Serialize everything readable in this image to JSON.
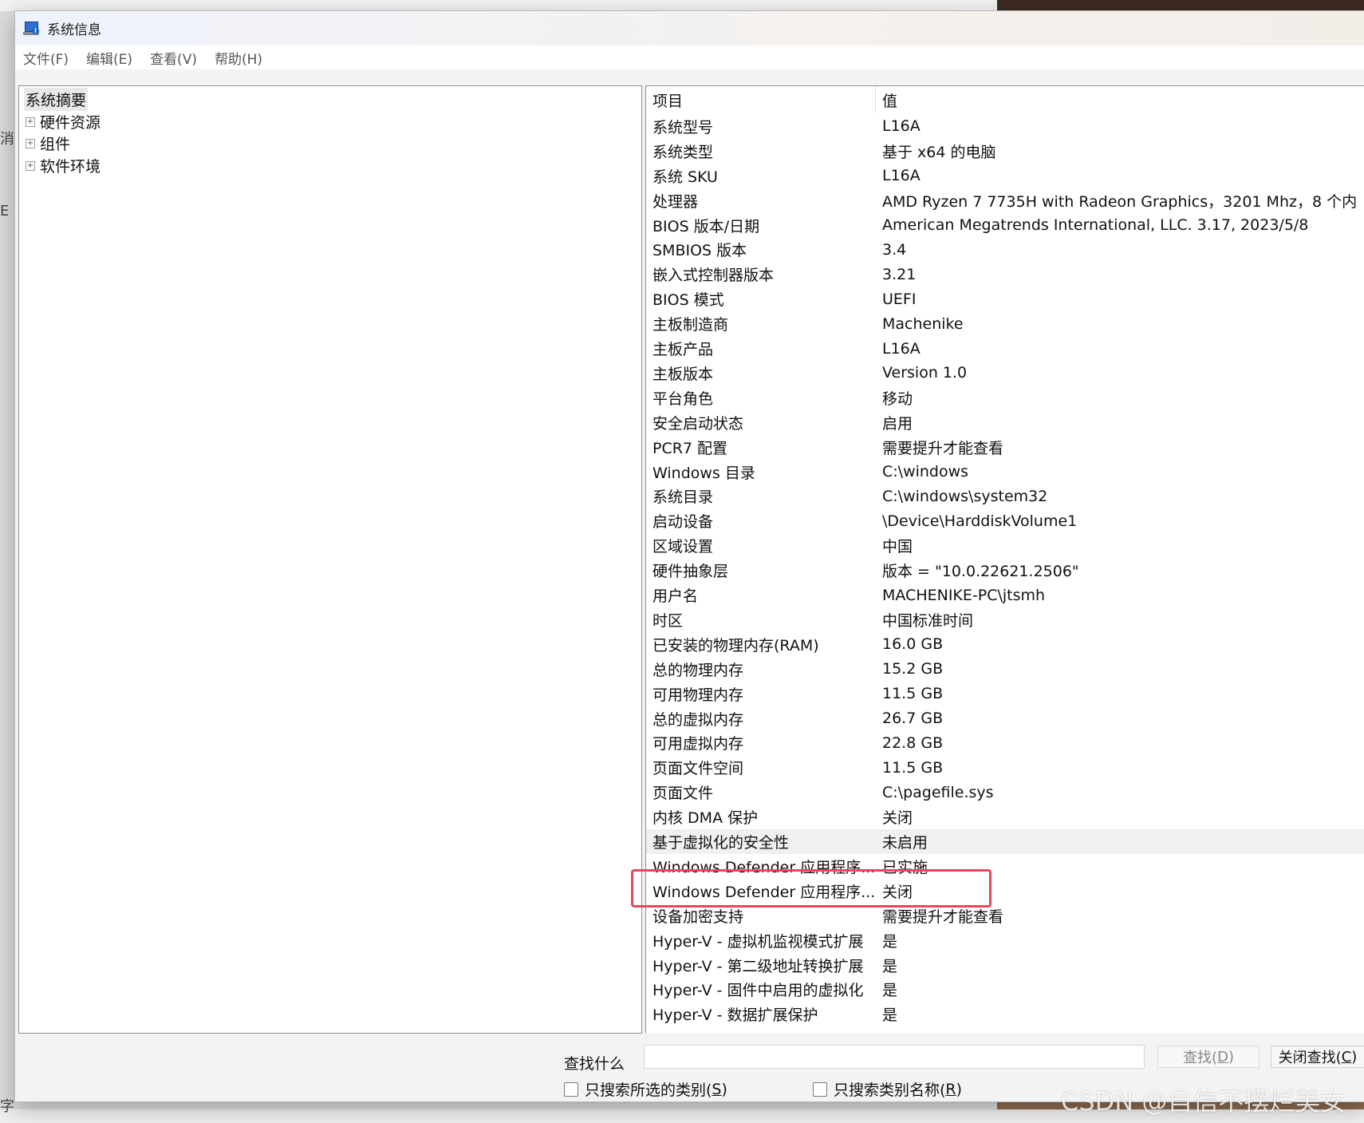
{
  "window": {
    "title": "系统信息",
    "menu": [
      "文件(F)",
      "编辑(E)",
      "查看(V)",
      "帮助(H)"
    ]
  },
  "tree": {
    "root": "系统摘要",
    "children": [
      "硬件资源",
      "组件",
      "软件环境"
    ]
  },
  "list": {
    "headers": {
      "item": "项目",
      "value": "值"
    },
    "rows": [
      {
        "item": "系统型号",
        "value": "L16A"
      },
      {
        "item": "系统类型",
        "value": "基于 x64 的电脑"
      },
      {
        "item": "系统 SKU",
        "value": "L16A"
      },
      {
        "item": "处理器",
        "value": "AMD Ryzen 7 7735H with Radeon Graphics，3201 Mhz，8 个内"
      },
      {
        "item": "BIOS 版本/日期",
        "value": "American Megatrends International, LLC. 3.17, 2023/5/8"
      },
      {
        "item": "SMBIOS 版本",
        "value": "3.4"
      },
      {
        "item": "嵌入式控制器版本",
        "value": "3.21"
      },
      {
        "item": "BIOS 模式",
        "value": "UEFI"
      },
      {
        "item": "主板制造商",
        "value": "Machenike"
      },
      {
        "item": "主板产品",
        "value": "L16A"
      },
      {
        "item": "主板版本",
        "value": "Version 1.0"
      },
      {
        "item": "平台角色",
        "value": "移动"
      },
      {
        "item": "安全启动状态",
        "value": "启用"
      },
      {
        "item": "PCR7 配置",
        "value": "需要提升才能查看"
      },
      {
        "item": "Windows 目录",
        "value": "C:\\windows"
      },
      {
        "item": "系统目录",
        "value": "C:\\windows\\system32"
      },
      {
        "item": "启动设备",
        "value": "\\Device\\HarddiskVolume1"
      },
      {
        "item": "区域设置",
        "value": "中国"
      },
      {
        "item": "硬件抽象层",
        "value": "版本 = \"10.0.22621.2506\""
      },
      {
        "item": "用户名",
        "value": "MACHENIKE-PC\\jtsmh"
      },
      {
        "item": "时区",
        "value": "中国标准时间"
      },
      {
        "item": "已安装的物理内存(RAM)",
        "value": "16.0 GB"
      },
      {
        "item": "总的物理内存",
        "value": "15.2 GB"
      },
      {
        "item": "可用物理内存",
        "value": "11.5 GB"
      },
      {
        "item": "总的虚拟内存",
        "value": "26.7 GB"
      },
      {
        "item": "可用虚拟内存",
        "value": "22.8 GB"
      },
      {
        "item": "页面文件空间",
        "value": "11.5 GB"
      },
      {
        "item": "页面文件",
        "value": "C:\\pagefile.sys"
      },
      {
        "item": "内核 DMA 保护",
        "value": "关闭"
      },
      {
        "item": "基于虚拟化的安全性",
        "value": "未启用"
      },
      {
        "item": "Windows Defender 应用程序...",
        "value": "已实施"
      },
      {
        "item": "Windows Defender 应用程序...",
        "value": "关闭"
      },
      {
        "item": "设备加密支持",
        "value": "需要提升才能查看"
      },
      {
        "item": "Hyper-V - 虚拟机监视模式扩展",
        "value": "是"
      },
      {
        "item": "Hyper-V - 第二级地址转换扩展",
        "value": "是"
      },
      {
        "item": "Hyper-V - 固件中启用的虚拟化",
        "value": "是"
      },
      {
        "item": "Hyper-V - 数据扩展保护",
        "value": "是"
      }
    ],
    "selected_index": 29
  },
  "find": {
    "label": "查找什么",
    "input_value": "",
    "find_button": {
      "text": "查找(",
      "key": "D",
      "tail": ")"
    },
    "close_button": {
      "text": "关闭查找(",
      "key": "C",
      "tail": ")"
    },
    "check1": {
      "text": "只搜索所选的类别(",
      "key": "S",
      "tail": ")"
    },
    "check2": {
      "text": "只搜索类别名称(",
      "key": "R",
      "tail": ")"
    }
  },
  "background": {
    "left_glyphs": [
      "消",
      "E"
    ],
    "bottom_left": "字"
  },
  "watermark": "CSDN @自信不摆烂美女",
  "colors": {
    "highlight_border": "#e8485c",
    "selected_row": "#f0f0f0",
    "window_bg": "#f3f3f3"
  }
}
